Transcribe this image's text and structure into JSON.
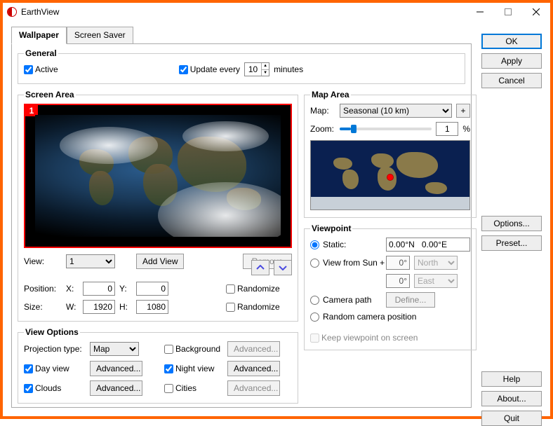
{
  "window": {
    "title": "EarthView"
  },
  "tabs": {
    "wallpaper": "Wallpaper",
    "saver": "Screen Saver"
  },
  "general": {
    "legend": "General",
    "active": "Active",
    "update_every": "Update every",
    "interval": "10",
    "unit": "minutes"
  },
  "screen": {
    "legend": "Screen Area",
    "badge": "1",
    "view_label": "View:",
    "view_value": "1",
    "add_view": "Add View",
    "remove": "Remove",
    "position_label": "Position:",
    "x_label": "X:",
    "x_value": "0",
    "y_label": "Y:",
    "y_value": "0",
    "size_label": "Size:",
    "w_label": "W:",
    "w_value": "1920",
    "h_label": "H:",
    "h_value": "1080",
    "randomize": "Randomize"
  },
  "viewopts": {
    "legend": "View Options",
    "projection_label": "Projection type:",
    "projection_value": "Map",
    "day": "Day view",
    "clouds": "Clouds",
    "background": "Background",
    "night": "Night view",
    "cities": "Cities",
    "advanced": "Advanced..."
  },
  "maparea": {
    "legend": "Map Area",
    "map_label": "Map:",
    "map_value": "Seasonal (10 km)",
    "plus": "+",
    "zoom_label": "Zoom:",
    "zoom_value": "1",
    "zoom_unit": "%"
  },
  "viewpoint": {
    "legend": "Viewpoint",
    "static": "Static:",
    "static_value": "0.00°N   0.00°E",
    "sun": "View from Sun +",
    "deg": "0°",
    "north": "North",
    "east": "East",
    "camera": "Camera path",
    "define": "Define...",
    "random": "Random camera position",
    "keep": "Keep viewpoint on screen"
  },
  "buttons": {
    "ok": "OK",
    "apply": "Apply",
    "cancel": "Cancel",
    "options": "Options...",
    "preset": "Preset...",
    "help": "Help",
    "about": "About...",
    "quit": "Quit"
  }
}
